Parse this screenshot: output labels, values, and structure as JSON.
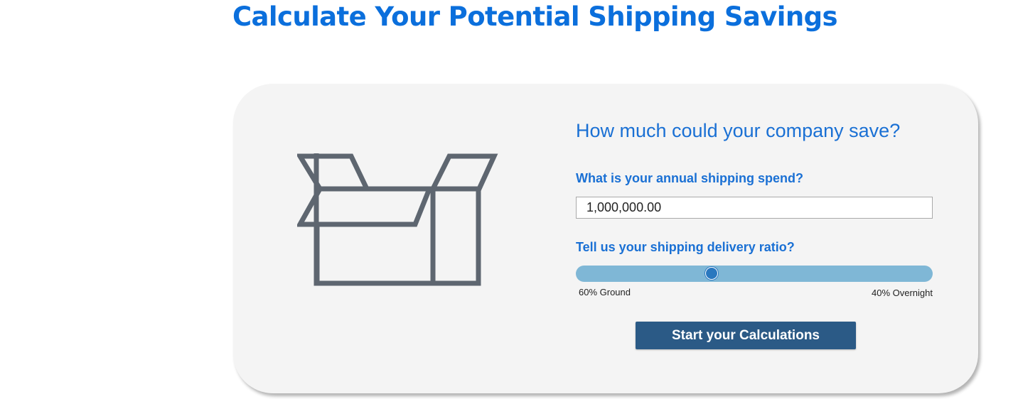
{
  "page": {
    "title": "Calculate Your Potential Shipping Savings"
  },
  "calculator": {
    "heading": "How much could your company save?",
    "spend_label": "What is your annual shipping spend?",
    "spend_value": "1,000,000.00",
    "ratio_label": "Tell us your shipping delivery ratio?",
    "ratio_ground_label": "60% Ground",
    "ratio_overnight_label": "40% Overnight",
    "ratio_ground_fraction": 0.38,
    "button_label": "Start your Calculations"
  },
  "icons": {
    "illustration": "open-box-icon"
  },
  "colors": {
    "title": "#0b6fdc",
    "heading": "#1a70d4",
    "card_background": "#f4f4f4",
    "box_stroke": "#5e6670",
    "slider_track": "#7fb7d6",
    "slider_thumb": "#2a78bf",
    "button_background": "#2b5a86",
    "button_text": "#ffffff"
  }
}
